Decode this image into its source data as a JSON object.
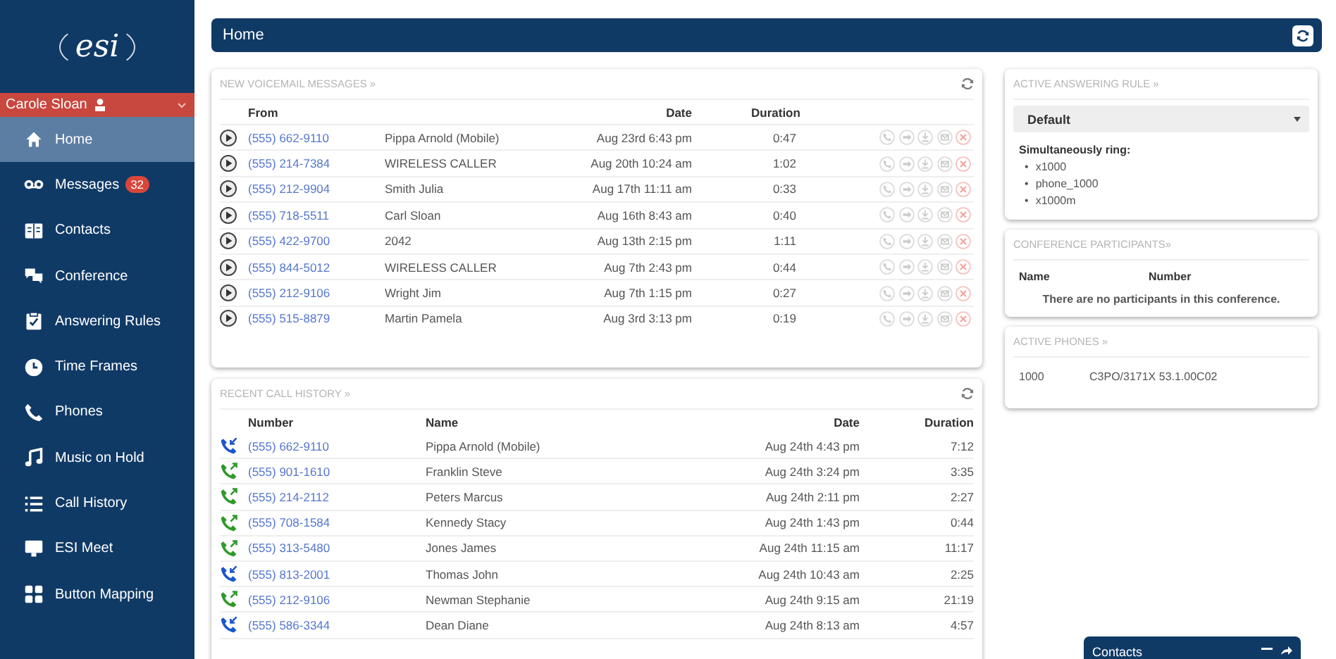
{
  "sidebar": {
    "logo": "esi",
    "user": {
      "name": "Carole Sloan"
    },
    "items": [
      {
        "label": "Home",
        "selected": true
      },
      {
        "label": "Messages",
        "selected": false,
        "badge": "32"
      },
      {
        "label": "Contacts",
        "selected": false
      },
      {
        "label": "Conference",
        "selected": false
      },
      {
        "label": "Answering Rules",
        "selected": false
      },
      {
        "label": "Time Frames",
        "selected": false
      },
      {
        "label": "Phones",
        "selected": false
      },
      {
        "label": "Music on Hold",
        "selected": false
      },
      {
        "label": "Call History",
        "selected": false
      },
      {
        "label": "ESI Meet",
        "selected": false
      },
      {
        "label": "Button Mapping",
        "selected": false
      }
    ]
  },
  "header": {
    "title": "Home"
  },
  "voicemail": {
    "title": "NEW VOICEMAIL MESSAGES »",
    "columns": [
      "From",
      "Date",
      "Duration"
    ],
    "rows": [
      {
        "number": "(555) 662-9110",
        "name": "Pippa Arnold (Mobile)",
        "date": "Aug 23rd 6:43 pm",
        "duration": "0:47"
      },
      {
        "number": "(555) 214-7384",
        "name": "WIRELESS CALLER",
        "date": "Aug 20th 10:24 am",
        "duration": "1:02"
      },
      {
        "number": "(555) 212-9904",
        "name": "Smith Julia",
        "date": "Aug 17th 11:11 am",
        "duration": "0:33"
      },
      {
        "number": "(555) 718-5511",
        "name": "Carl Sloan",
        "date": "Aug 16th 8:43 am",
        "duration": "0:40"
      },
      {
        "number": "(555) 422-9700",
        "name": "2042",
        "date": "Aug 13th 2:15 pm",
        "duration": "1:11"
      },
      {
        "number": "(555) 844-5012",
        "name": "WIRELESS CALLER",
        "date": "Aug 7th 2:43 pm",
        "duration": "0:44"
      },
      {
        "number": "(555) 212-9106",
        "name": "Wright Jim",
        "date": "Aug 7th 1:15 pm",
        "duration": "0:27"
      },
      {
        "number": "(555) 515-8879",
        "name": "Martin Pamela",
        "date": "Aug 3rd 3:13 pm",
        "duration": "0:19"
      }
    ]
  },
  "call_history": {
    "title": "RECENT CALL HISTORY »",
    "columns": [
      "Number",
      "Name",
      "Date",
      "Duration"
    ],
    "rows": [
      {
        "kind": "incoming",
        "number": "(555) 662-9110",
        "name": "Pippa Arnold (Mobile)",
        "date": "Aug 24th 4:43 pm",
        "duration": "7:12"
      },
      {
        "kind": "outgoing",
        "number": "(555) 901-1610",
        "name": "Franklin Steve",
        "date": "Aug 24th 3:24 pm",
        "duration": "3:35"
      },
      {
        "kind": "outgoing",
        "number": "(555) 214-2112",
        "name": "Peters Marcus",
        "date": "Aug 24th 2:11 pm",
        "duration": "2:27"
      },
      {
        "kind": "outgoing",
        "number": "(555) 708-1584",
        "name": "Kennedy Stacy",
        "date": "Aug 24th 1:43 pm",
        "duration": "0:44"
      },
      {
        "kind": "outgoing",
        "number": "(555) 313-5480",
        "name": "Jones James",
        "date": "Aug 24th 11:15 am",
        "duration": "11:17"
      },
      {
        "kind": "incoming",
        "number": "(555) 813-2001",
        "name": "Thomas John",
        "date": "Aug 24th 10:43 am",
        "duration": "2:25"
      },
      {
        "kind": "outgoing",
        "number": "(555) 212-9106",
        "name": "Newman Stephanie",
        "date": "Aug 24th 9:15 am",
        "duration": "21:19"
      },
      {
        "kind": "incoming",
        "number": "(555) 586-3344",
        "name": "Dean Diane",
        "date": "Aug 24th 8:13 am",
        "duration": "4:57"
      }
    ]
  },
  "answering_rule": {
    "title": "ACTIVE ANSWERING RULE »",
    "select": {
      "value": "Default"
    },
    "ring_label": "Simultaneously ring:",
    "ring": [
      {
        "bullet": "•",
        "label": "x1000"
      },
      {
        "bullet": "•",
        "label": "phone_1000"
      },
      {
        "bullet": "•",
        "label": "x1000m"
      }
    ]
  },
  "conference": {
    "title": "CONFERENCE PARTICIPANTS»",
    "columns": [
      "Name",
      "Number"
    ],
    "empty": "There are no participants in this conference."
  },
  "active_phones": {
    "title": "ACTIVE PHONES »",
    "rows": [
      {
        "extension": "1000",
        "model": "C3PO/3171X 53.1.00C02"
      }
    ]
  },
  "chat_tab": {
    "title": "Contacts"
  }
}
